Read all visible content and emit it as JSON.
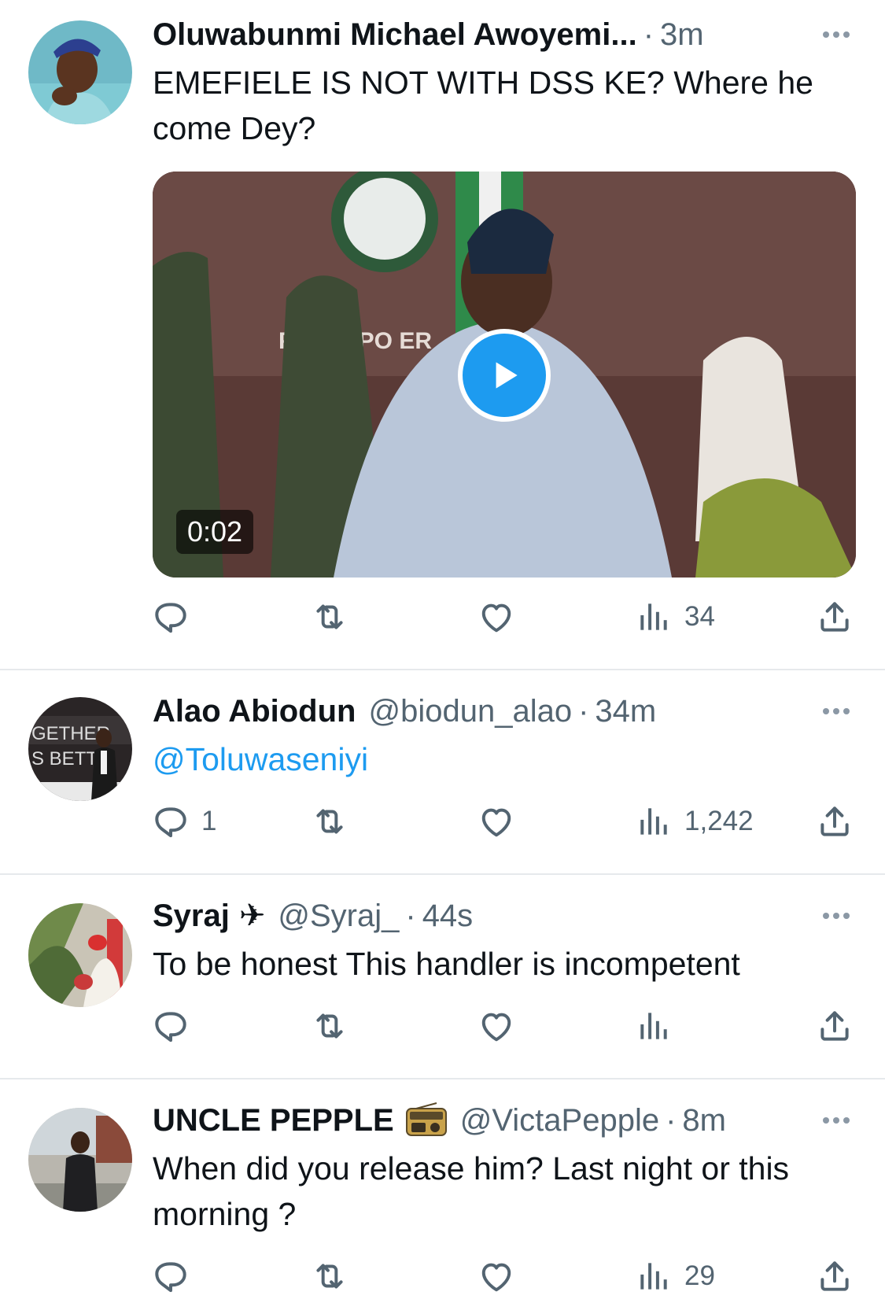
{
  "tweets": [
    {
      "name": "Oluwabunmi Michael Awoyemi...",
      "handle": "",
      "separator": "·",
      "time": "3m",
      "text": "EMEFIELE IS NOT WITH DSS KE? Where he come Dey?",
      "video_duration": "0:02",
      "video_caption_text": "PRI   DAPO     ER",
      "reply_count": "",
      "retweet_count": "",
      "like_count": "",
      "view_count": "34"
    },
    {
      "name": "Alao Abiodun",
      "handle": "@biodun_alao",
      "separator": "·",
      "time": "34m",
      "text": "@Toluwaseniyi",
      "reply_count": "1",
      "retweet_count": "",
      "like_count": "",
      "view_count": "1,242"
    },
    {
      "name": "Syraj",
      "name_emoji": "✈",
      "handle": "@Syraj_",
      "separator": "·",
      "time": "44s",
      "text": "To be honest This handler is incompetent",
      "reply_count": "",
      "retweet_count": "",
      "like_count": "",
      "view_count": ""
    },
    {
      "name": "UNCLE PEPPLE",
      "name_emoji_icon": "radio-icon",
      "handle": "@VictaPepple",
      "separator": "·",
      "time": "8m",
      "text": "When did you release him? Last night or this morning ?",
      "reply_count": "",
      "retweet_count": "",
      "like_count": "",
      "view_count": "29"
    }
  ],
  "colors": {
    "accent": "#1d9bf0",
    "secondary_text": "#536471",
    "primary_text": "#0f1419",
    "divider": "#e6e9ec"
  }
}
